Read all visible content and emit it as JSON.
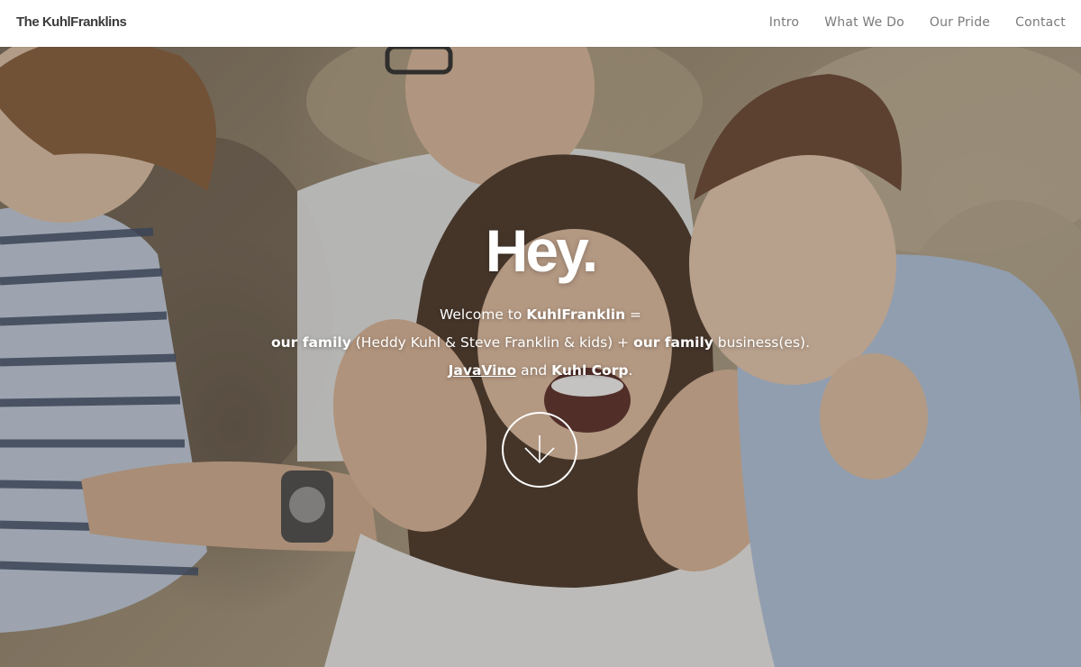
{
  "header": {
    "brand": "The KuhlFranklins",
    "nav": [
      {
        "label": "Intro"
      },
      {
        "label": "What We Do"
      },
      {
        "label": "Our Pride"
      },
      {
        "label": "Contact"
      }
    ]
  },
  "hero": {
    "title": "Hey.",
    "line1": {
      "prefix": "Welcome to ",
      "strong": "KuhlFranklin",
      "suffix": " ="
    },
    "line2": {
      "strong1": "our family",
      "middle": " (Heddy Kuhl & Steve Franklin & kids) + ",
      "strong2": "our family",
      "suffix": " business(es)."
    },
    "line3": {
      "link": "JavaVino",
      "middle": " and ",
      "strong": "Kuhl Corp",
      "suffix": "."
    },
    "scroll_icon": "arrow-down-circle-icon"
  },
  "colors": {
    "header_bg": "#ffffff",
    "brand_text": "#3b3b3b",
    "nav_text": "#7a7a7a",
    "hero_text": "#ffffff"
  }
}
